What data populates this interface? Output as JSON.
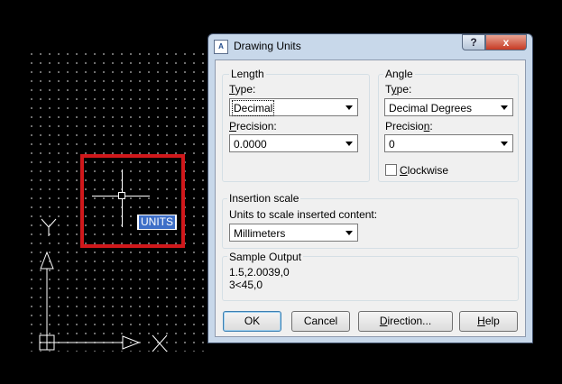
{
  "canvas": {
    "command_text": "UNITS",
    "ucs_x_label": "X",
    "ucs_y_label": "Y"
  },
  "dialog": {
    "app_icon_text": "A",
    "title": "Drawing Units",
    "help_symbol": "?",
    "close_symbol": "x",
    "length": {
      "group_label": "Length",
      "type_label_pre": "",
      "type_label_u": "T",
      "type_label_post": "ype:",
      "type_value": "Decimal",
      "precision_label_pre": "",
      "precision_label_u": "P",
      "precision_label_post": "recision:",
      "precision_value": "0.0000"
    },
    "angle": {
      "group_label": "Angle",
      "type_label_pre": "T",
      "type_label_u": "y",
      "type_label_post": "pe:",
      "type_value": "Decimal Degrees",
      "precision_label_pre": "Precisio",
      "precision_label_u": "n",
      "precision_label_post": ":",
      "precision_value": "0",
      "clockwise_u": "C",
      "clockwise_post": "lockwise",
      "clockwise_checked": false
    },
    "insertion": {
      "group_label": "Insertion scale",
      "units_label": "Units to scale inserted content:",
      "units_value": "Millimeters"
    },
    "sample": {
      "group_label": "Sample Output",
      "line1": "1.5,2.0039,0",
      "line2": "3<45,0"
    },
    "buttons": {
      "ok": "OK",
      "cancel": "Cancel",
      "direction_u": "D",
      "direction_post": "irection...",
      "help_u": "H",
      "help_post": "elp"
    }
  }
}
